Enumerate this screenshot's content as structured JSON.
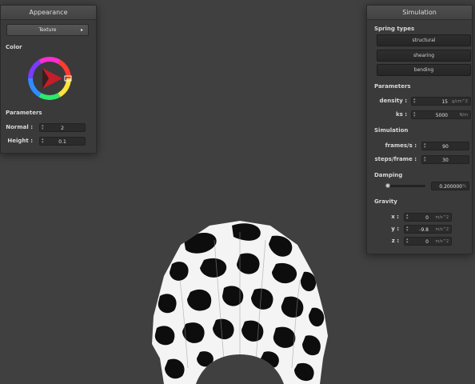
{
  "appearance": {
    "title": "Appearance",
    "shader_select": "Texture",
    "color_label": "Color",
    "parameters_label": "Parameters",
    "normal_label": "Normal :",
    "normal_value": "2",
    "height_label": "Height :",
    "height_value": "0.1"
  },
  "simulation": {
    "title": "Simulation",
    "spring_types_label": "Spring types",
    "spring_types": [
      "structural",
      "shearing",
      "bending"
    ],
    "parameters_label": "Parameters",
    "density_label": "density :",
    "density_value": "15",
    "density_unit": "g/cm^2",
    "ks_label": "ks :",
    "ks_value": "5000",
    "ks_unit": "N/m",
    "simulation_label": "Simulation",
    "fps_label": "frames/s :",
    "fps_value": "90",
    "steps_label": "steps/frame :",
    "steps_value": "30",
    "damping_label": "Damping",
    "damping_value": "0.200000",
    "damping_unit": "%",
    "damping_level": 0.02,
    "gravity_label": "Gravity",
    "gx_label": "x :",
    "gx_value": "0",
    "gy_label": "y :",
    "gy_value": "-9.8",
    "gz_label": "z :",
    "gz_value": "0",
    "gravity_unit": "m/s^2"
  },
  "colors": {
    "background": "#404040",
    "panel": "#3a3a3a",
    "wheel_selected": "#e52d2d"
  }
}
